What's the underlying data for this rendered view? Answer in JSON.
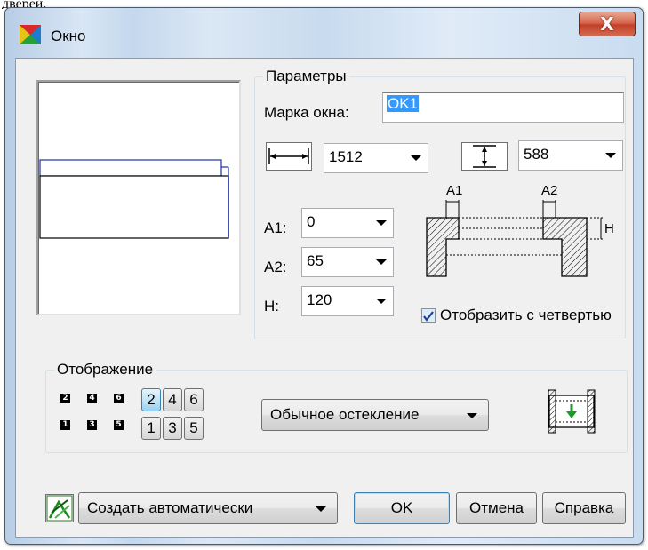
{
  "top_crop_text": "дверей.",
  "window": {
    "title": "Окно",
    "close_glyph": "X"
  },
  "parameters": {
    "group_title": "Параметры",
    "mark_label": "Марка окна:",
    "mark_value": "OK1",
    "width_value": "1512",
    "height_value": "588",
    "a1_label": "A1:",
    "a1_value": "0",
    "a2_label": "A2:",
    "a2_value": "65",
    "h_label": "H:",
    "h_value": "120",
    "diagram_a1": "A1",
    "diagram_a2": "A2",
    "diagram_h": "H",
    "quarter_checkbox_label": "Отобразить с четвертью",
    "quarter_checked": true
  },
  "display": {
    "group_title": "Отображение",
    "small_top": [
      "2",
      "4",
      "6"
    ],
    "small_bottom": [
      "1",
      "3",
      "5"
    ],
    "buttons_top": [
      "2",
      "4",
      "6"
    ],
    "buttons_bottom": [
      "1",
      "3",
      "5"
    ],
    "active_button": "2",
    "glazing_value": "Обычное остекление"
  },
  "footer": {
    "create_mode_value": "Создать автоматически",
    "ok_label": "OK",
    "cancel_label": "Отмена",
    "help_label": "Справка"
  },
  "colors": {
    "preview_outline": "#1f2f9f",
    "selection": "#3399ff",
    "close_button": "#c7432d"
  }
}
